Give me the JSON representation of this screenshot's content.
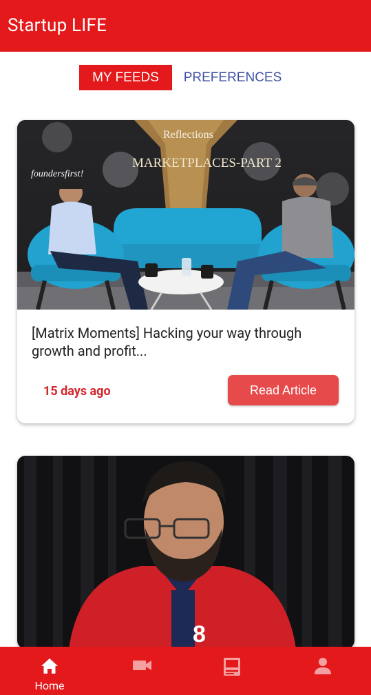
{
  "app": {
    "title": "Startup LIFE"
  },
  "tabs": [
    {
      "label": "MY FEEDS",
      "active": true
    },
    {
      "label": "PREFERENCES",
      "active": false
    }
  ],
  "feed": [
    {
      "title": "[Matrix Moments] Hacking your way through growth and profit...",
      "time": "15 days ago",
      "action_label": "Read Article",
      "image_description": "Two men talking on blue chairs, MARKETPLACES - PART 2 backdrop",
      "image_text": {
        "headline": "MARKETPLACES-PART 2",
        "brand": "Reflections",
        "handle": "foundersfirst!"
      }
    },
    {
      "title": "",
      "image_description": "Man with beard and glasses in red polo shirt before dark curtain"
    }
  ],
  "bottom_nav": [
    {
      "icon": "home-icon",
      "label": "Home",
      "active": true
    },
    {
      "icon": "video-icon",
      "label": "",
      "active": false
    },
    {
      "icon": "article-icon",
      "label": "",
      "active": false
    },
    {
      "icon": "profile-icon",
      "label": "",
      "active": false
    }
  ],
  "colors": {
    "brand": "#e3191b",
    "button": "#e64a4a",
    "tab_inactive": "#3f51a5",
    "time": "#d4262d"
  }
}
